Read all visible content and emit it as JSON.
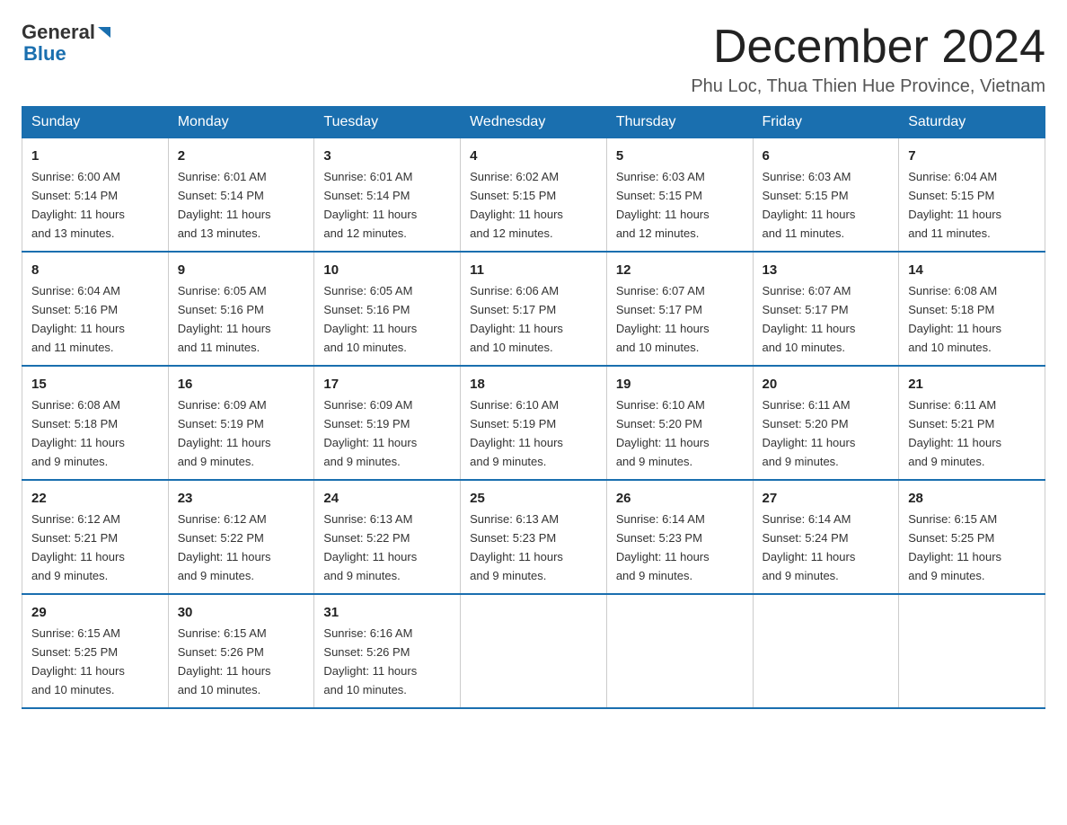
{
  "logo": {
    "general": "General",
    "arrow": "▶",
    "blue": "Blue"
  },
  "header": {
    "month": "December 2024",
    "location": "Phu Loc, Thua Thien Hue Province, Vietnam"
  },
  "days_of_week": [
    "Sunday",
    "Monday",
    "Tuesday",
    "Wednesday",
    "Thursday",
    "Friday",
    "Saturday"
  ],
  "weeks": [
    [
      {
        "num": "1",
        "sunrise": "6:00 AM",
        "sunset": "5:14 PM",
        "daylight": "11 hours and 13 minutes."
      },
      {
        "num": "2",
        "sunrise": "6:01 AM",
        "sunset": "5:14 PM",
        "daylight": "11 hours and 13 minutes."
      },
      {
        "num": "3",
        "sunrise": "6:01 AM",
        "sunset": "5:14 PM",
        "daylight": "11 hours and 12 minutes."
      },
      {
        "num": "4",
        "sunrise": "6:02 AM",
        "sunset": "5:15 PM",
        "daylight": "11 hours and 12 minutes."
      },
      {
        "num": "5",
        "sunrise": "6:03 AM",
        "sunset": "5:15 PM",
        "daylight": "11 hours and 12 minutes."
      },
      {
        "num": "6",
        "sunrise": "6:03 AM",
        "sunset": "5:15 PM",
        "daylight": "11 hours and 11 minutes."
      },
      {
        "num": "7",
        "sunrise": "6:04 AM",
        "sunset": "5:15 PM",
        "daylight": "11 hours and 11 minutes."
      }
    ],
    [
      {
        "num": "8",
        "sunrise": "6:04 AM",
        "sunset": "5:16 PM",
        "daylight": "11 hours and 11 minutes."
      },
      {
        "num": "9",
        "sunrise": "6:05 AM",
        "sunset": "5:16 PM",
        "daylight": "11 hours and 11 minutes."
      },
      {
        "num": "10",
        "sunrise": "6:05 AM",
        "sunset": "5:16 PM",
        "daylight": "11 hours and 10 minutes."
      },
      {
        "num": "11",
        "sunrise": "6:06 AM",
        "sunset": "5:17 PM",
        "daylight": "11 hours and 10 minutes."
      },
      {
        "num": "12",
        "sunrise": "6:07 AM",
        "sunset": "5:17 PM",
        "daylight": "11 hours and 10 minutes."
      },
      {
        "num": "13",
        "sunrise": "6:07 AM",
        "sunset": "5:17 PM",
        "daylight": "11 hours and 10 minutes."
      },
      {
        "num": "14",
        "sunrise": "6:08 AM",
        "sunset": "5:18 PM",
        "daylight": "11 hours and 10 minutes."
      }
    ],
    [
      {
        "num": "15",
        "sunrise": "6:08 AM",
        "sunset": "5:18 PM",
        "daylight": "11 hours and 9 minutes."
      },
      {
        "num": "16",
        "sunrise": "6:09 AM",
        "sunset": "5:19 PM",
        "daylight": "11 hours and 9 minutes."
      },
      {
        "num": "17",
        "sunrise": "6:09 AM",
        "sunset": "5:19 PM",
        "daylight": "11 hours and 9 minutes."
      },
      {
        "num": "18",
        "sunrise": "6:10 AM",
        "sunset": "5:19 PM",
        "daylight": "11 hours and 9 minutes."
      },
      {
        "num": "19",
        "sunrise": "6:10 AM",
        "sunset": "5:20 PM",
        "daylight": "11 hours and 9 minutes."
      },
      {
        "num": "20",
        "sunrise": "6:11 AM",
        "sunset": "5:20 PM",
        "daylight": "11 hours and 9 minutes."
      },
      {
        "num": "21",
        "sunrise": "6:11 AM",
        "sunset": "5:21 PM",
        "daylight": "11 hours and 9 minutes."
      }
    ],
    [
      {
        "num": "22",
        "sunrise": "6:12 AM",
        "sunset": "5:21 PM",
        "daylight": "11 hours and 9 minutes."
      },
      {
        "num": "23",
        "sunrise": "6:12 AM",
        "sunset": "5:22 PM",
        "daylight": "11 hours and 9 minutes."
      },
      {
        "num": "24",
        "sunrise": "6:13 AM",
        "sunset": "5:22 PM",
        "daylight": "11 hours and 9 minutes."
      },
      {
        "num": "25",
        "sunrise": "6:13 AM",
        "sunset": "5:23 PM",
        "daylight": "11 hours and 9 minutes."
      },
      {
        "num": "26",
        "sunrise": "6:14 AM",
        "sunset": "5:23 PM",
        "daylight": "11 hours and 9 minutes."
      },
      {
        "num": "27",
        "sunrise": "6:14 AM",
        "sunset": "5:24 PM",
        "daylight": "11 hours and 9 minutes."
      },
      {
        "num": "28",
        "sunrise": "6:15 AM",
        "sunset": "5:25 PM",
        "daylight": "11 hours and 9 minutes."
      }
    ],
    [
      {
        "num": "29",
        "sunrise": "6:15 AM",
        "sunset": "5:25 PM",
        "daylight": "11 hours and 10 minutes."
      },
      {
        "num": "30",
        "sunrise": "6:15 AM",
        "sunset": "5:26 PM",
        "daylight": "11 hours and 10 minutes."
      },
      {
        "num": "31",
        "sunrise": "6:16 AM",
        "sunset": "5:26 PM",
        "daylight": "11 hours and 10 minutes."
      },
      null,
      null,
      null,
      null
    ]
  ],
  "labels": {
    "sunrise": "Sunrise:",
    "sunset": "Sunset:",
    "daylight": "Daylight:"
  }
}
